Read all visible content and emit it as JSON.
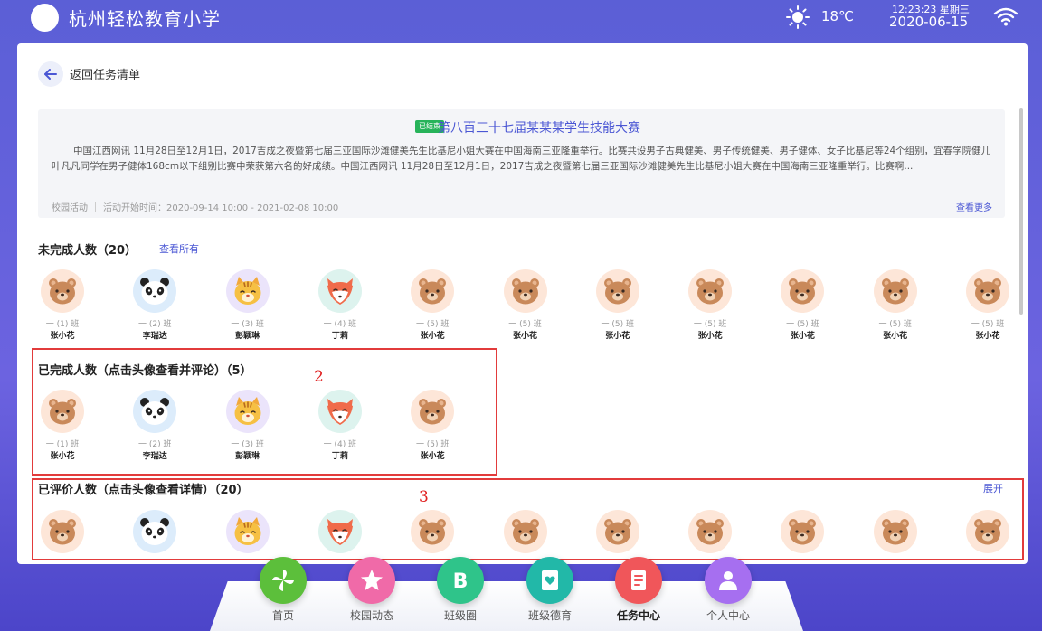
{
  "header": {
    "school_name": "杭州轻松教育小学",
    "temperature": "18℃",
    "time": "12:23:23 星期三",
    "date": "2020-06-15"
  },
  "nav": {
    "back_label": "返回任务清单"
  },
  "task": {
    "status_badge": "已结束",
    "title": "第八百三十七届某某某学生技能大赛",
    "description": "中国江西网讯 11月28日至12月1日，2017吉成之夜暨第七届三亚国际沙滩健美先生比基尼小姐大赛在中国海南三亚隆重举行。比赛共设男子古典健美、男子传统健美、男子健体、女子比基尼等24个组别，宜春学院健儿叶凡凡同学在男子健体168cm以下组别比赛中荣获第六名的好成绩。中国江西网讯 11月28日至12月1日，2017吉成之夜暨第七届三亚国际沙滩健美先生比基尼小姐大赛在中国海南三亚隆重举行。比赛啊...",
    "category": "校园活动",
    "time_range": "活动开始时间：2020-09-14 10:00 - 2021-02-08 10:00",
    "more_label": "查看更多"
  },
  "unfinished": {
    "title": "未完成人数（20）",
    "link": "查看所有",
    "students": [
      {
        "animal": "bear",
        "cls": "一 (1) 班",
        "name": "张小花"
      },
      {
        "animal": "panda",
        "cls": "一 (2) 班",
        "name": "李瑞达"
      },
      {
        "animal": "tiger",
        "cls": "一 (3) 班",
        "name": "彭颖琳"
      },
      {
        "animal": "fox",
        "cls": "一 (4) 班",
        "name": "丁莉"
      },
      {
        "animal": "bear",
        "cls": "一 (5) 班",
        "name": "张小花"
      },
      {
        "animal": "bear",
        "cls": "一 (5) 班",
        "name": "张小花"
      },
      {
        "animal": "bear",
        "cls": "一 (5) 班",
        "name": "张小花"
      },
      {
        "animal": "bear",
        "cls": "一 (5) 班",
        "name": "张小花"
      },
      {
        "animal": "bear",
        "cls": "一 (5) 班",
        "name": "张小花"
      },
      {
        "animal": "bear",
        "cls": "一 (5) 班",
        "name": "张小花"
      },
      {
        "animal": "bear",
        "cls": "一 (5) 班",
        "name": "张小花"
      }
    ]
  },
  "finished": {
    "title": "已完成人数（点击头像查看并评论）（5）",
    "annotation": "2",
    "students": [
      {
        "animal": "bear",
        "cls": "一 (1) 班",
        "name": "张小花"
      },
      {
        "animal": "panda",
        "cls": "一 (2) 班",
        "name": "李瑞达"
      },
      {
        "animal": "tiger",
        "cls": "一 (3) 班",
        "name": "彭颖琳"
      },
      {
        "animal": "fox",
        "cls": "一 (4) 班",
        "name": "丁莉"
      },
      {
        "animal": "bear",
        "cls": "一 (5) 班",
        "name": "张小花"
      }
    ]
  },
  "evaluated": {
    "title": "已评价人数（点击头像查看详情）（20）",
    "annotation": "3",
    "expand_label": "展开",
    "students": [
      {
        "animal": "bear"
      },
      {
        "animal": "panda"
      },
      {
        "animal": "tiger"
      },
      {
        "animal": "fox"
      },
      {
        "animal": "bear"
      },
      {
        "animal": "bear"
      },
      {
        "animal": "bear"
      },
      {
        "animal": "bear"
      },
      {
        "animal": "bear"
      },
      {
        "animal": "bear"
      },
      {
        "animal": "bear"
      }
    ]
  },
  "dock": [
    {
      "label": "首页",
      "icon": "pinwheel-icon",
      "color": "#5cbf3b"
    },
    {
      "label": "校园动态",
      "icon": "star-icon",
      "color": "#f06aa8"
    },
    {
      "label": "班级圈",
      "icon": "b-letter-icon",
      "color": "#2fc48a"
    },
    {
      "label": "班级德育",
      "icon": "heart-card-icon",
      "color": "#22b8a8"
    },
    {
      "label": "任务中心",
      "icon": "task-doc-icon",
      "color": "#f0565a",
      "active": true
    },
    {
      "label": "个人中心",
      "icon": "person-icon",
      "color": "#a66ff0"
    }
  ]
}
